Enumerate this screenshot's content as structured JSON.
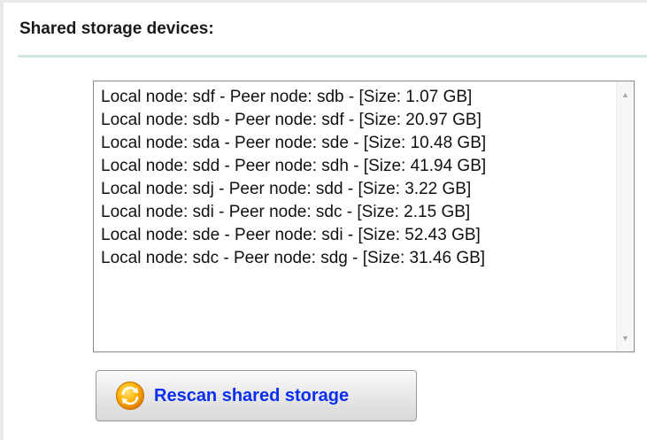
{
  "section": {
    "title": "Shared storage devices:"
  },
  "device_list": {
    "items": [
      "Local node: sdf - Peer node: sdb - [Size: 1.07 GB]",
      "Local node: sdb - Peer node: sdf - [Size: 20.97 GB]",
      "Local node: sda - Peer node: sde - [Size: 10.48 GB]",
      "Local node: sdd - Peer node: sdh - [Size: 41.94 GB]",
      "Local node: sdj - Peer node: sdd - [Size: 3.22 GB]",
      "Local node: sdi - Peer node: sdc - [Size: 2.15 GB]",
      "Local node: sde - Peer node: sdi - [Size: 52.43 GB]",
      "Local node: sdc - Peer node: sdg - [Size: 31.46 GB]"
    ]
  },
  "actions": {
    "rescan_label": "Rescan shared storage",
    "rescan_icon": "refresh-icon"
  },
  "colors": {
    "section_divider": "#cfe6e4",
    "button_text": "#0a2ff0",
    "icon_orange": "#f5a000"
  }
}
